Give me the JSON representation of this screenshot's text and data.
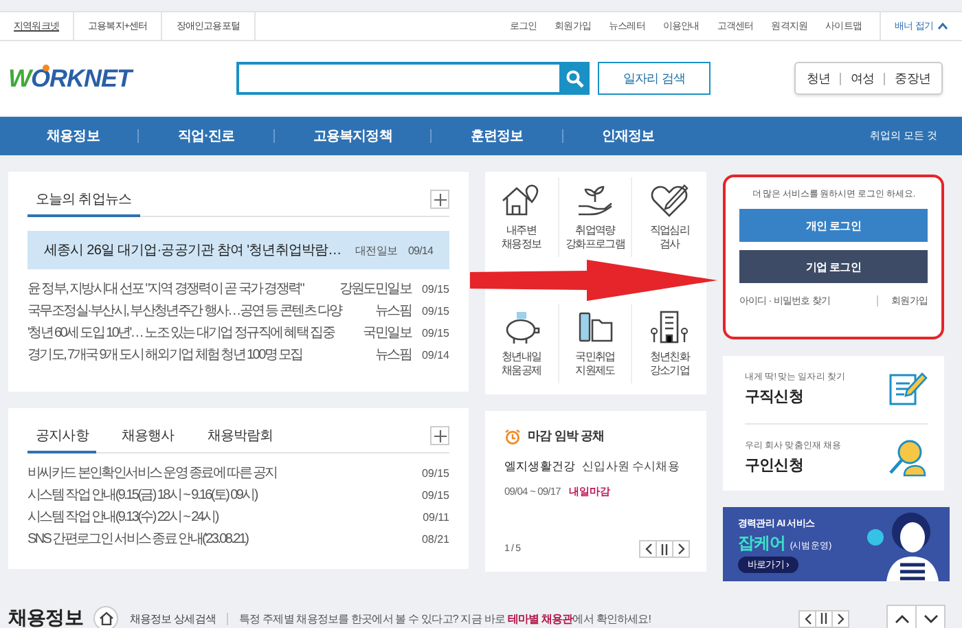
{
  "top_bar": {
    "left_links": [
      "지역워크넷",
      "고용복지+센터",
      "장애인고용포털"
    ],
    "right_links": [
      "로그인",
      "회원가입",
      "뉴스레터",
      "이용안내",
      "고객센터",
      "원격지원",
      "사이트맵"
    ],
    "banner_toggle": "배너 접기"
  },
  "header": {
    "logo": "WORKNET",
    "search_button": "일자리 검색",
    "target_links": [
      "청년",
      "여성",
      "중장년"
    ]
  },
  "nav": {
    "items": [
      "채용정보",
      "직업·진로",
      "고용복지정책",
      "훈련정보",
      "인재정보"
    ],
    "all_menu": "취업의 모든 것"
  },
  "news": {
    "tabs": [
      {
        "label": "오늘의 취업뉴스",
        "selected": true
      }
    ],
    "featured": {
      "title": "세종시 26일 대기업·공공기관 참여 '청년취업박람…",
      "source": "대전일보",
      "date": "09/14"
    },
    "items": [
      {
        "title": "윤 정부, 지방시대 선포 \"지역 경쟁력이 곧 국가 경쟁력\"",
        "source": "강원도민일보",
        "date": "09/15"
      },
      {
        "title": "국무조정실·부산시, 부산청년주간 행사…공연 등 콘텐츠 다양",
        "source": "뉴스핌",
        "date": "09/15"
      },
      {
        "title": "'청년 60세 도입 10년'… 노조 있는 대기업 정규직에 혜택 집중",
        "source": "국민일보",
        "date": "09/15"
      },
      {
        "title": "경기도, 7개국 9개 도시 해외기업 체험 청년 100명 모집",
        "source": "뉴스핌",
        "date": "09/14"
      }
    ]
  },
  "quick_menu": [
    {
      "label": "내주변\n채용정보"
    },
    {
      "label": "취업역량\n강화프로그램"
    },
    {
      "label": "직업심리\n검사"
    },
    {
      "label": "청년내일\n채움공제"
    },
    {
      "label": "국민취업\n지원제도"
    },
    {
      "label": "청년친화\n강소기업"
    }
  ],
  "login": {
    "highlighted": true,
    "message": "더 많은 서비스를 원하시면 로그인 하세요.",
    "buttons": [
      {
        "label": "개인 로그인",
        "kind": "personal"
      },
      {
        "label": "기업 로그인",
        "kind": "business"
      }
    ],
    "find_link": "아이디 · 비밀번호 찾기",
    "join_link": "회원가입"
  },
  "apply_cards": [
    {
      "caption": "내게 딱! 맞는 일자리 찾기",
      "title": "구직신청"
    },
    {
      "caption": "우리 회사 맞춤인재 채용",
      "title": "구인신청"
    }
  ],
  "notices": {
    "tabs": [
      {
        "label": "공지사항",
        "selected": true
      },
      {
        "label": "채용행사",
        "selected": false
      },
      {
        "label": "채용박람회",
        "selected": false
      }
    ],
    "items": [
      {
        "title": "비씨카드 본인확인서비스 운영 종료에 따른 공지",
        "date": "09/15"
      },
      {
        "title": "시스템 작업 안내(9.15(금) 18시 ~ 9.16(토) 09시)",
        "date": "09/15"
      },
      {
        "title": "시스템 작업 안내(9.13(수) 22시 ~ 24시)",
        "date": "09/11"
      },
      {
        "title": "SNS 간편로그인 서비스 종료 안내('23.08.21)",
        "date": "08/21"
      }
    ]
  },
  "deadline": {
    "title": "마감 임박 공채",
    "company": "엘지생활건강",
    "position": "신입사원 수시채용",
    "period": "09/04 ~ 09/17",
    "badge": "내일마감",
    "page": "1 / 5"
  },
  "banner": {
    "caption": "경력관리 AI 서비스",
    "title": "잡케어",
    "note": "(시범운영)",
    "button": "바로가기 ›"
  },
  "jobs_section": {
    "title": "채용정보",
    "detail_link": "채용정보 상세검색",
    "notice": "특정 주제별 채용정보를 한곳에서 볼 수 있다고? 지금 바로 **테마별 채용관**에서 확인하세요!"
  },
  "annotation": {
    "arrow": true
  }
}
